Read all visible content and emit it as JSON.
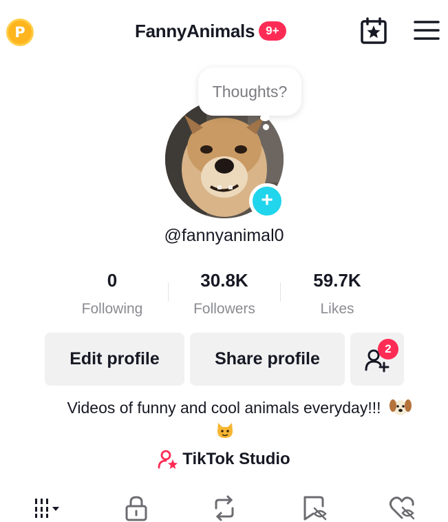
{
  "header": {
    "coin_label": "P",
    "title": "FannyAnimals",
    "notification_badge": "9+",
    "icons": [
      "coin-icon",
      "calendar-star-icon",
      "hamburger-menu-icon"
    ]
  },
  "profile": {
    "thought_bubble": "Thoughts?",
    "username": "@fannyanimal0",
    "add_icon": "plus-icon"
  },
  "stats": [
    {
      "value": "0",
      "label": "Following"
    },
    {
      "value": "30.8K",
      "label": "Followers"
    },
    {
      "value": "59.7K",
      "label": "Likes"
    }
  ],
  "actions": {
    "edit_label": "Edit profile",
    "share_label": "Share profile",
    "add_friend_badge": "2"
  },
  "bio": {
    "text": "Videos of funny and cool animals everyday!!!",
    "emojis": [
      "dog-face-emoji",
      "cat-face-emoji"
    ]
  },
  "studio": {
    "label": "TikTok Studio"
  },
  "tabs": [
    "videos-grid-tab",
    "private-lock-tab",
    "reposts-tab",
    "favorites-tab",
    "liked-tab"
  ],
  "colors": {
    "accent_red": "#fe2c55",
    "plus_cyan": "#20d5ec",
    "coin_gold": "#ffb51d",
    "muted_text": "#8a8b91",
    "button_bg": "#f1f1f2"
  }
}
